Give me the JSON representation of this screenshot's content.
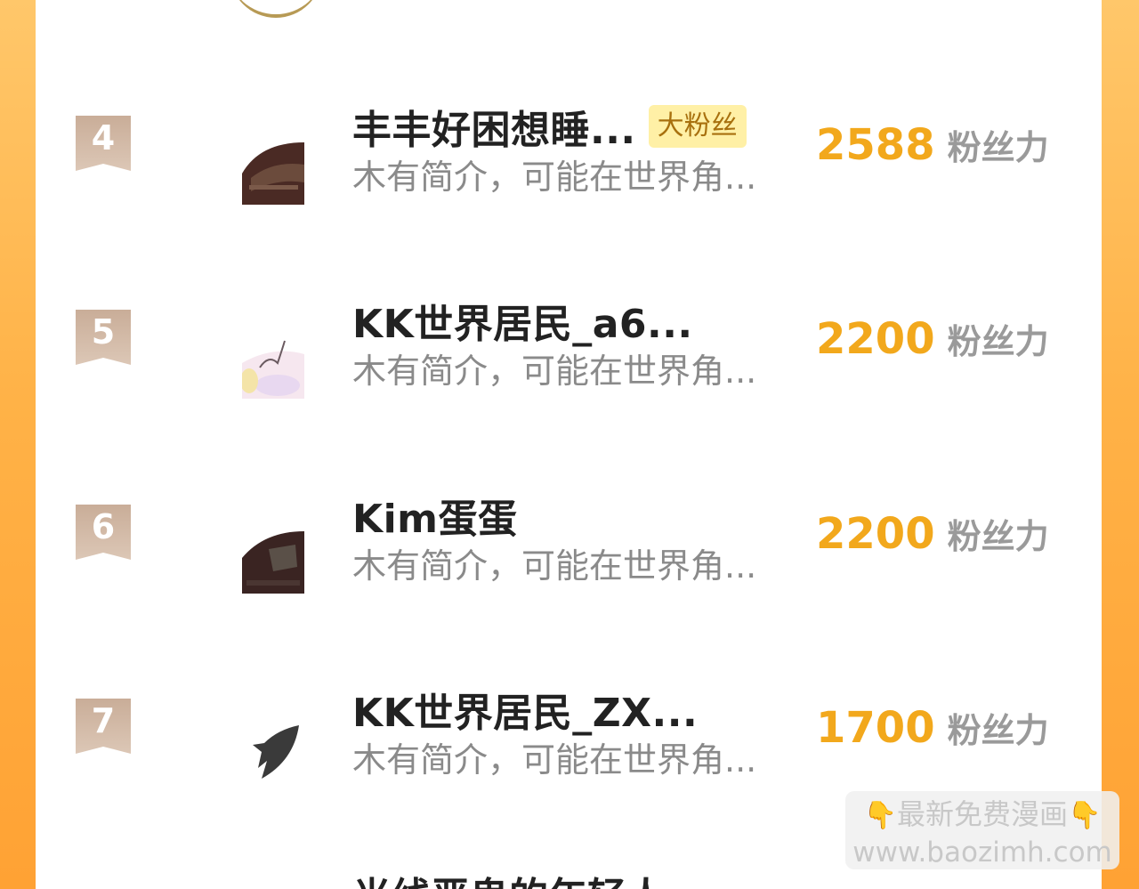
{
  "rows": [
    {
      "rank": "4",
      "name": "丰丰好困想睡...",
      "badge": "大粉丝",
      "intro": "木有简介，可能在世界角...",
      "score": "2588",
      "unit": "粉丝力"
    },
    {
      "rank": "5",
      "name": "KK世界居民_a6...",
      "intro": "木有简介，可能在世界角...",
      "score": "2200",
      "unit": "粉丝力"
    },
    {
      "rank": "6",
      "name": "Kim蛋蛋",
      "intro": "木有简介，可能在世界角...",
      "score": "2200",
      "unit": "粉丝力"
    },
    {
      "rank": "7",
      "name": "KK世界居民_ZX...",
      "intro": "木有简介，可能在世界角...",
      "score": "1700",
      "unit": "粉丝力"
    }
  ],
  "partial_next_name": "光线恶鬼的年轻人",
  "watermark": {
    "line1": "最新免费漫画",
    "line2": "www.baozimh.com",
    "hand_icon": "pointing-down-hand-icon"
  },
  "colors": {
    "background_orange": "#ffb247",
    "score_orange": "#f2a81c",
    "rank_flag": "#d2bba8",
    "badge_bg": "#fff0a6"
  }
}
